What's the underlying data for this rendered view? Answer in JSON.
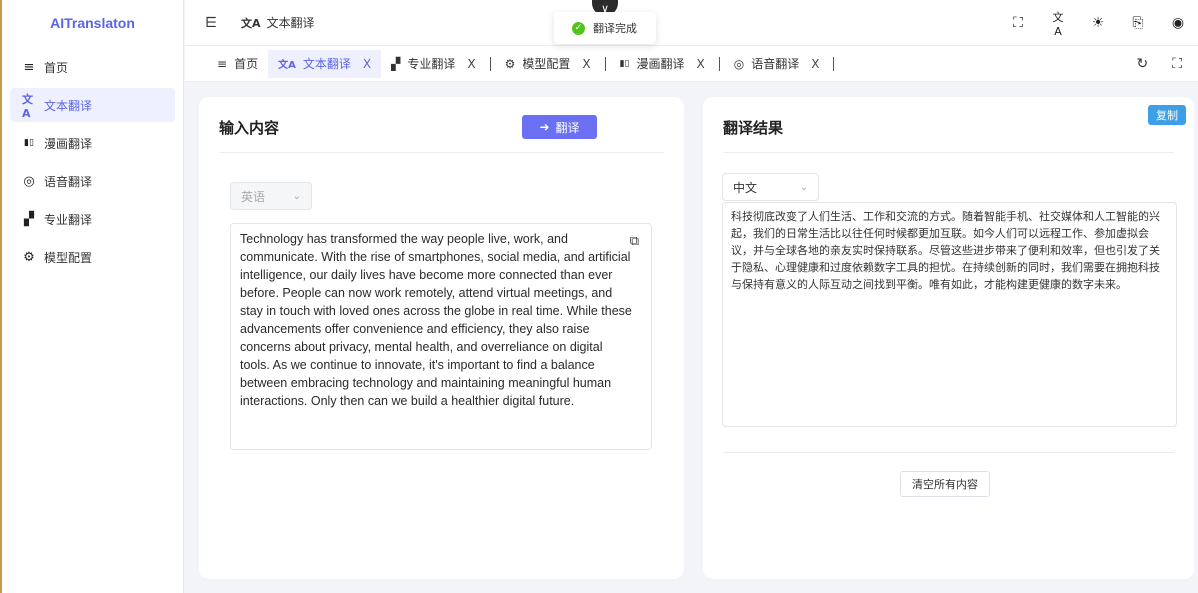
{
  "app": {
    "logo": "AITranslaton"
  },
  "sidebar": {
    "items": [
      {
        "label": "首页",
        "icon": "menu-icon",
        "glyph": "≡"
      },
      {
        "label": "文本翻译",
        "icon": "translate-icon",
        "glyph": "文A"
      },
      {
        "label": "漫画翻译",
        "icon": "book-icon",
        "glyph": "▮▯"
      },
      {
        "label": "语音翻译",
        "icon": "voice-icon",
        "glyph": "◎"
      },
      {
        "label": "专业翻译",
        "icon": "pro-translate-icon",
        "glyph": "▞"
      },
      {
        "label": "模型配置",
        "icon": "gear-icon",
        "glyph": "⚙"
      }
    ]
  },
  "header": {
    "breadcrumb": "文本翻译",
    "right_icons": [
      "fullscreen-icon",
      "language-icon",
      "theme-icon",
      "screenshot-icon",
      "github-icon"
    ]
  },
  "tabs": {
    "items": [
      {
        "label": "首页",
        "closable": false
      },
      {
        "label": "文本翻译",
        "closable": true,
        "active": true
      },
      {
        "label": "专业翻译",
        "closable": true
      },
      {
        "label": "模型配置",
        "closable": true
      },
      {
        "label": "漫画翻译",
        "closable": true
      },
      {
        "label": "语音翻译",
        "closable": true
      }
    ],
    "close_glyph": "X"
  },
  "toast": {
    "message": "翻译完成",
    "color": "#52c41a"
  },
  "input_panel": {
    "title": "输入内容",
    "translate_button": "翻译",
    "source_language": "英语",
    "source_text": "Technology has transformed the way people live, work, and communicate. With the rise of smartphones, social media, and artificial intelligence, our daily lives have become more connected than ever before. People can now work remotely, attend virtual meetings, and stay in touch with loved ones across the globe in real time. While these advancements offer convenience and efficiency, they also raise concerns about privacy, mental health, and overreliance on digital tools. As we continue to innovate, it's important to find a balance between embracing technology and maintaining meaningful human interactions. Only then can we build a healthier digital future."
  },
  "result_panel": {
    "title": "翻译结果",
    "copy_button": "复制",
    "target_language": "中文",
    "result_text": "科技彻底改变了人们生活、工作和交流的方式。随着智能手机、社交媒体和人工智能的兴起，我们的日常生活比以往任何时候都更加互联。如今人们可以远程工作、参加虚拟会议，并与全球各地的亲友实时保持联系。尽管这些进步带来了便利和效率，但也引发了关于隐私、心理健康和过度依赖数字工具的担忧。在持续创新的同时，我们需要在拥抱科技与保持有意义的人际互动之间找到平衡。唯有如此，才能构建更健康的数字未来。",
    "clear_button": "清空所有内容"
  },
  "colors": {
    "accent": "#5b63e6",
    "button": "#6b70f2",
    "copy": "#3d9fe8"
  }
}
